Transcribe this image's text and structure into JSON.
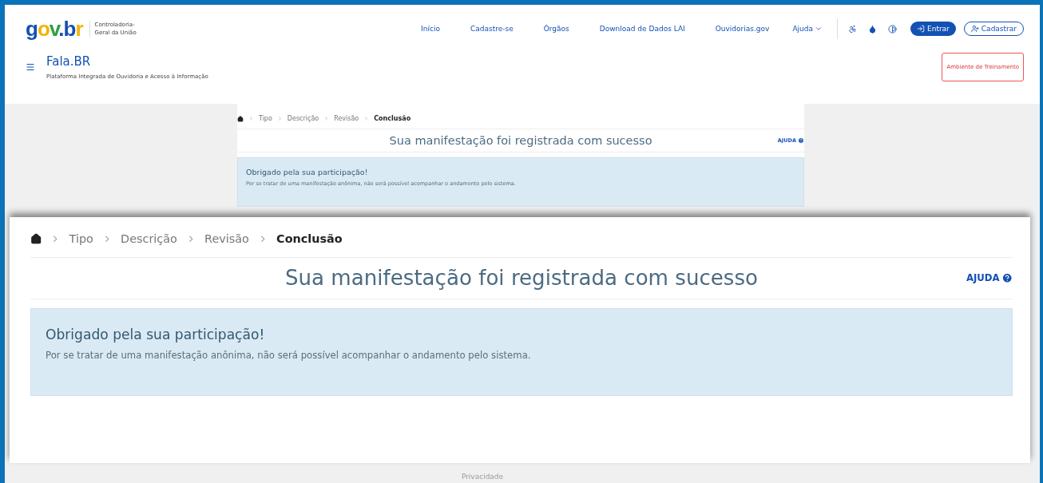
{
  "header": {
    "logo": "gov.br",
    "org_name": "Controladoria-Geral da União",
    "nav": [
      "Início",
      "Cadastre-se",
      "Órgãos",
      "Download de Dados LAI",
      "Ouvidorias.gov"
    ],
    "dropdown": "Ajuda",
    "login_button": "Entrar",
    "register_button": "Cadastrar",
    "app_title": "Fala.BR",
    "app_subtitle": "Plataforma Integrada de Ouvidoria e Acesso à Informação",
    "environment_badge": "Ambiente de Treinamento"
  },
  "page": {
    "breadcrumb": [
      {
        "label": "Tipo",
        "current": false
      },
      {
        "label": "Descrição",
        "current": false
      },
      {
        "label": "Revisão",
        "current": false
      },
      {
        "label": "Conclusão",
        "current": true
      }
    ],
    "title": "Sua manifestação foi registrada com sucesso",
    "help": "AJUDA",
    "alert": {
      "heading": "Obrigado pela sua participação!",
      "text": "Por se tratar de uma manifestação anônima, não será possível acompanhar o andamento pelo sistema."
    }
  },
  "zoom_inset": {
    "breadcrumb": [
      {
        "label": "Tipo",
        "current": false
      },
      {
        "label": "Descrição",
        "current": false
      },
      {
        "label": "Revisão",
        "current": false
      },
      {
        "label": "Conclusão",
        "current": true
      }
    ],
    "title": "Sua manifestação foi registrada com sucesso",
    "help": "AJUDA",
    "alert": {
      "heading": "Obrigado pela sua participação!",
      "text": "Por se tratar de uma manifestação anônima, não será possível acompanhar o andamento pelo sistema."
    }
  },
  "footer": {
    "link": "Privacidade"
  }
}
